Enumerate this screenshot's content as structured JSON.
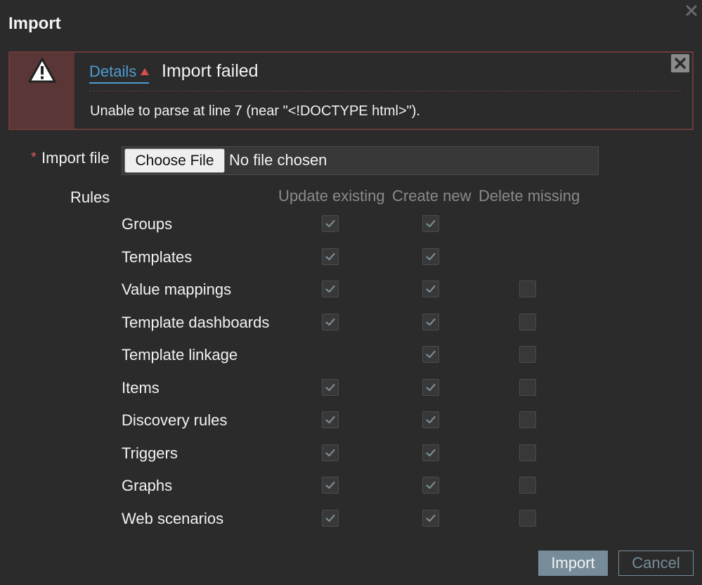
{
  "dialog": {
    "title": "Import",
    "close_icon": "close-x-icon"
  },
  "error": {
    "details_label": "Details",
    "title": "Import failed",
    "message": "Unable to parse at line 7 (near \"<!DOCTYPE html>\").",
    "icon": "warning-triangle-icon",
    "colors": {
      "background": "#5a3636",
      "border": "#6b3a3a",
      "link": "#4f9bd0",
      "arrow": "#d64e4e"
    }
  },
  "import_file": {
    "label": "Import file",
    "required_mark": "*",
    "choose_label": "Choose File",
    "no_file_text": "No file chosen"
  },
  "rules": {
    "label": "Rules",
    "columns": [
      "Update existing",
      "Create new",
      "Delete missing"
    ],
    "rows": [
      {
        "label": "Groups",
        "update": true,
        "create": true,
        "delete": null
      },
      {
        "label": "Templates",
        "update": true,
        "create": true,
        "delete": null
      },
      {
        "label": "Value mappings",
        "update": true,
        "create": true,
        "delete": false
      },
      {
        "label": "Template dashboards",
        "update": true,
        "create": true,
        "delete": false
      },
      {
        "label": "Template linkage",
        "update": null,
        "create": true,
        "delete": false
      },
      {
        "label": "Items",
        "update": true,
        "create": true,
        "delete": false
      },
      {
        "label": "Discovery rules",
        "update": true,
        "create": true,
        "delete": false
      },
      {
        "label": "Triggers",
        "update": true,
        "create": true,
        "delete": false
      },
      {
        "label": "Graphs",
        "update": true,
        "create": true,
        "delete": false
      },
      {
        "label": "Web scenarios",
        "update": true,
        "create": true,
        "delete": false
      }
    ]
  },
  "buttons": {
    "import_label": "Import",
    "cancel_label": "Cancel",
    "accent": "#768d99"
  }
}
